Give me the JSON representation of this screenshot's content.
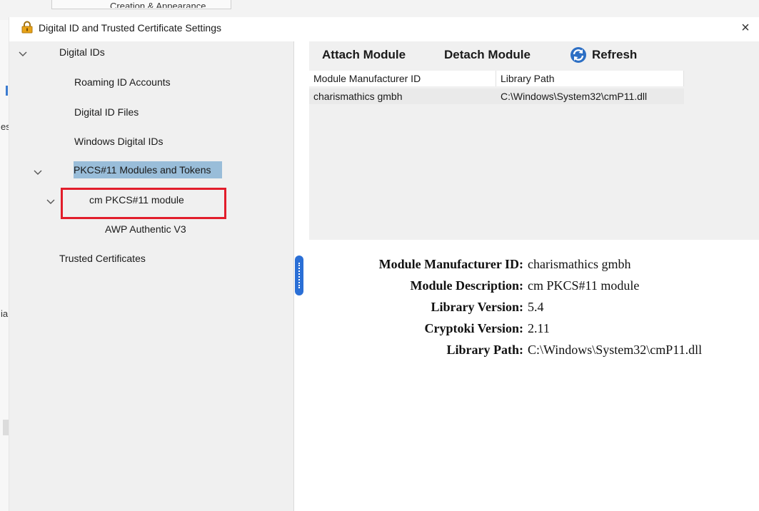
{
  "background": {
    "tab_text": "Creation & Appearance",
    "frag1": "es",
    "frag2": "ia"
  },
  "window": {
    "title": "Digital ID and Trusted Certificate Settings",
    "close_label": "×"
  },
  "tree": {
    "items": [
      {
        "label": "Digital IDs"
      },
      {
        "label": "Roaming ID Accounts"
      },
      {
        "label": "Digital ID Files"
      },
      {
        "label": "Windows Digital IDs"
      },
      {
        "label": "PKCS#11 Modules and Tokens"
      },
      {
        "label": "cm PKCS#11 module"
      },
      {
        "label": "AWP Authentic V3"
      },
      {
        "label": "Trusted Certificates"
      }
    ]
  },
  "toolbar": {
    "attach_label": "Attach Module",
    "detach_label": "Detach Module",
    "refresh_label": "Refresh"
  },
  "table": {
    "columns": [
      "Module Manufacturer ID",
      "Library Path"
    ],
    "rows": [
      [
        "charismathics gmbh",
        "C:\\Windows\\System32\\cmP11.dll"
      ]
    ]
  },
  "details": [
    {
      "label": "Module Manufacturer ID:",
      "value": "charismathics gmbh"
    },
    {
      "label": "Module Description:",
      "value": "cm PKCS#11 module"
    },
    {
      "label": "Library Version:",
      "value": "5.4"
    },
    {
      "label": "Cryptoki Version:",
      "value": "2.11"
    },
    {
      "label": "Library Path:",
      "value": "C:\\Windows\\System32\\cmP11.dll"
    }
  ],
  "colors": {
    "selection": "#99bdd9",
    "highlight": "#e21d2b",
    "splitter": "#2a6fd6"
  }
}
